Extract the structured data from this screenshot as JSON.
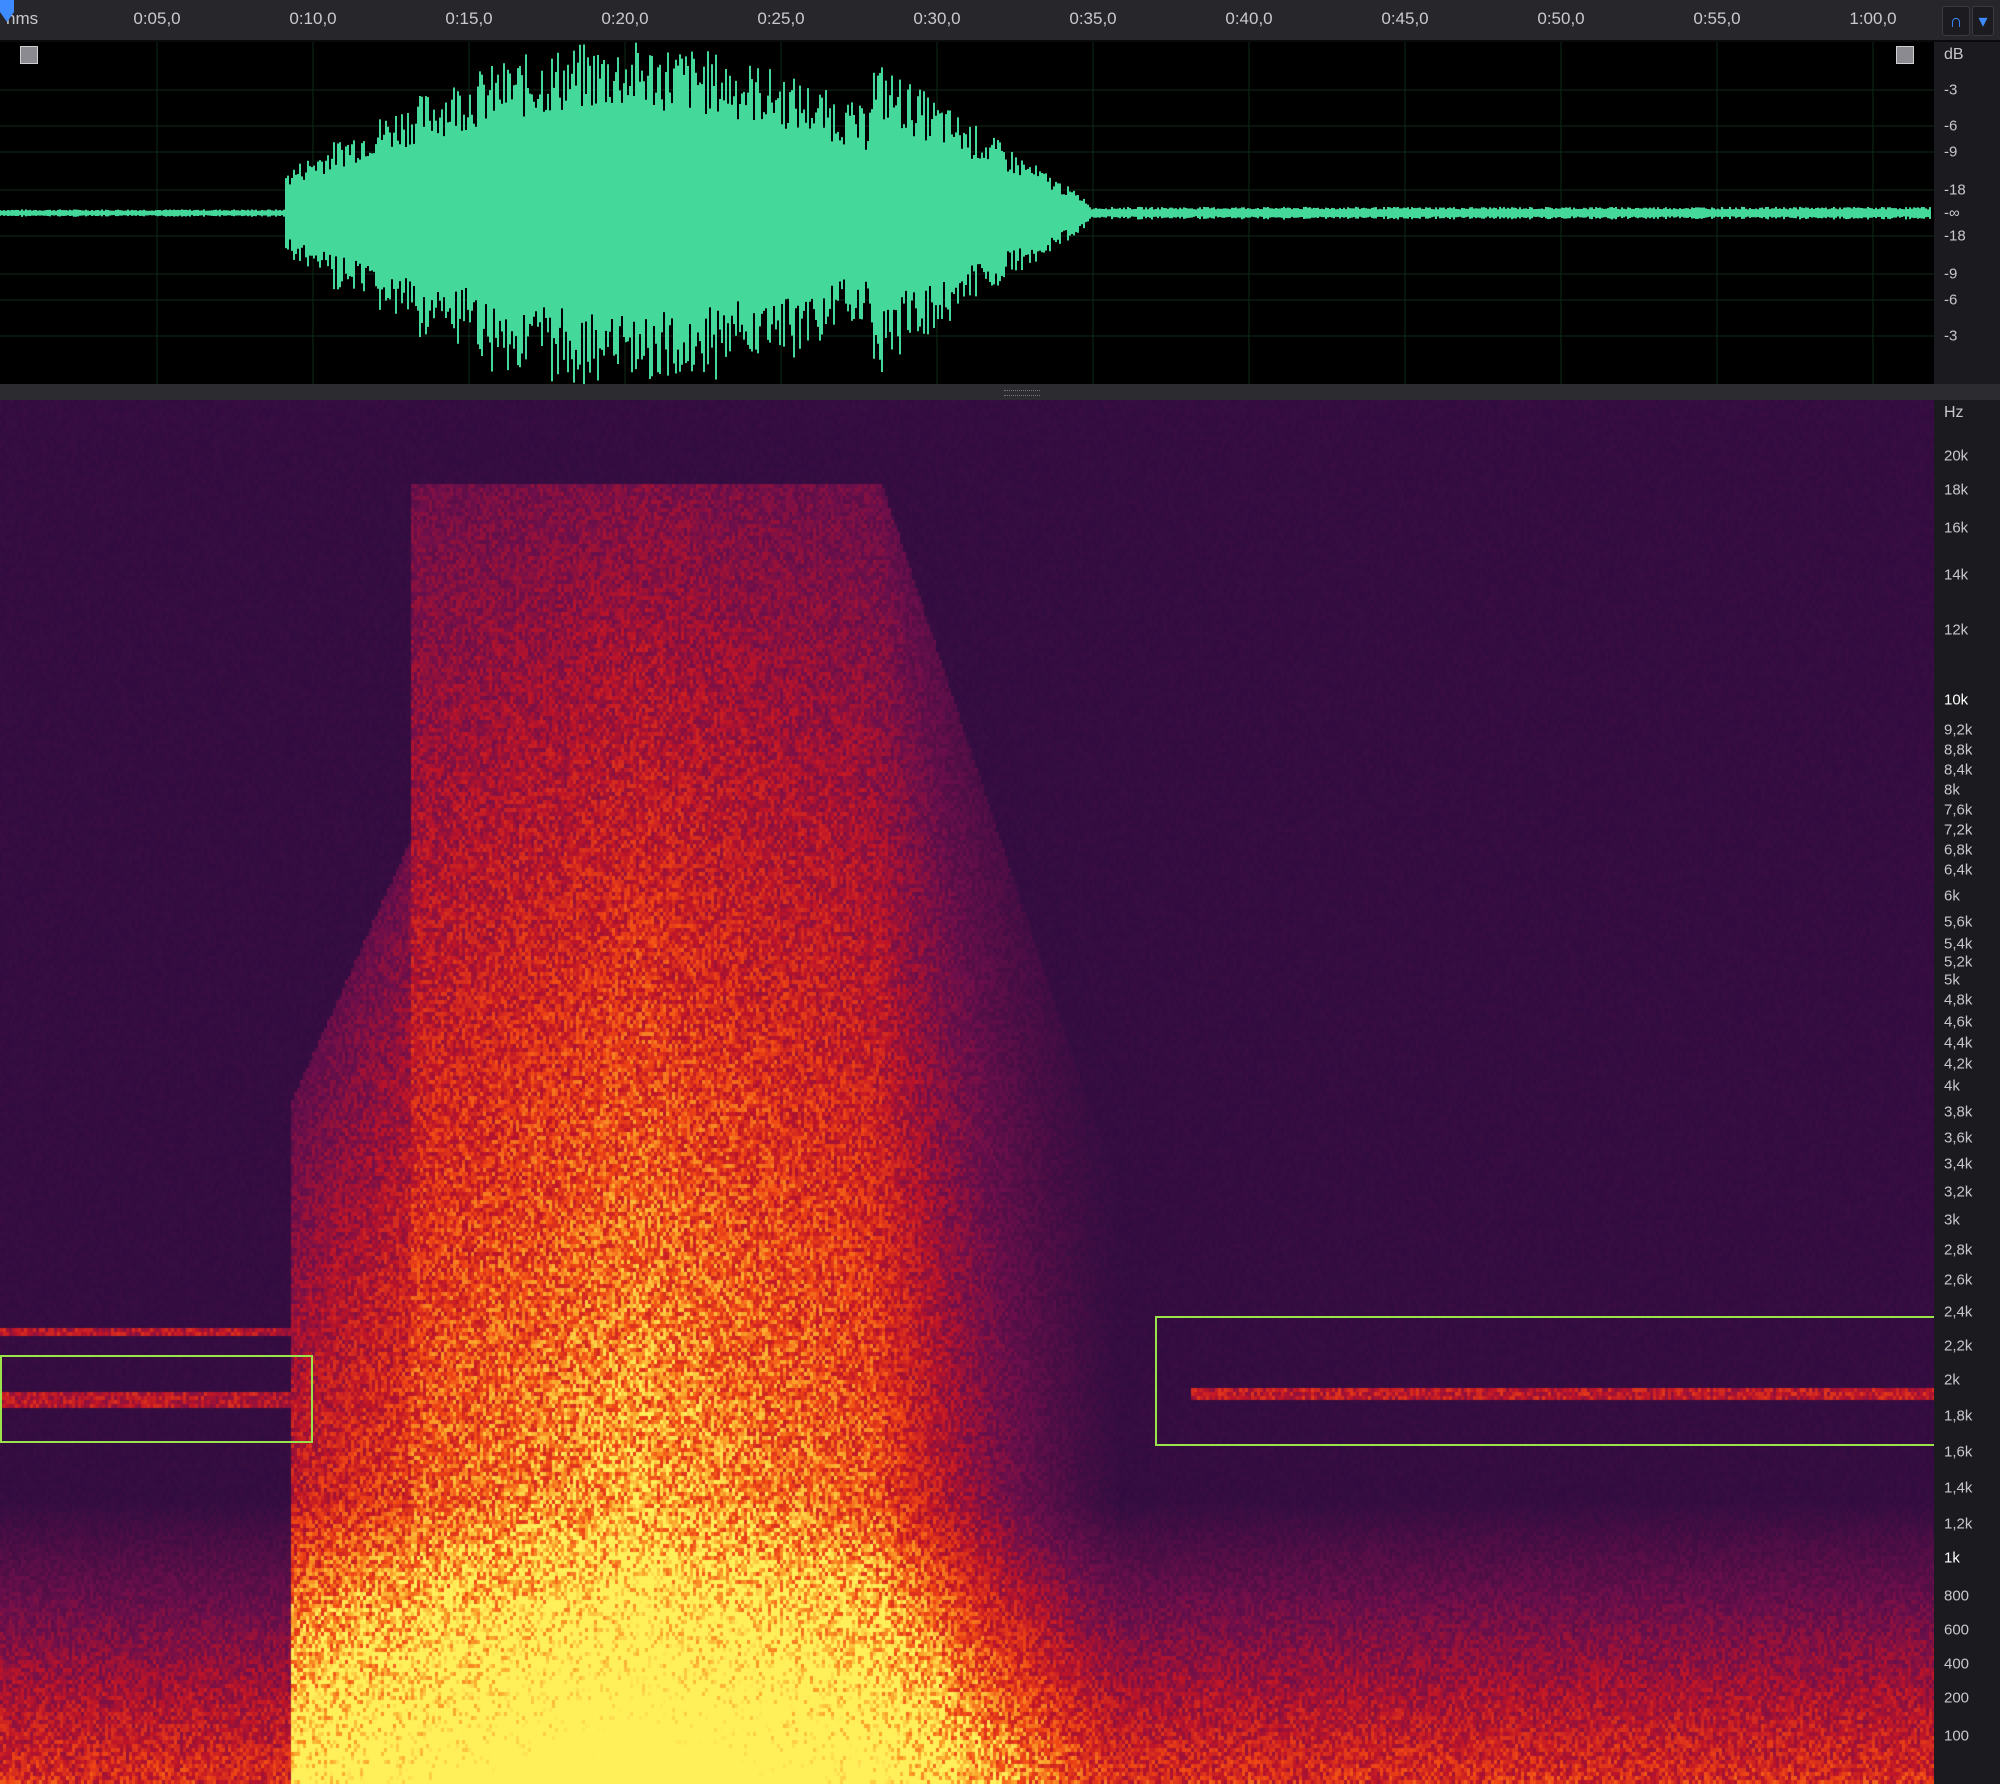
{
  "timeline": {
    "unit": "hms",
    "ticks": [
      "0:05,0",
      "0:10,0",
      "0:15,0",
      "0:20,0",
      "0:25,0",
      "0:30,0",
      "0:35,0",
      "0:40,0",
      "0:45,0",
      "0:50,0",
      "0:55,0",
      "1:00,0"
    ]
  },
  "toolbar": {
    "buttons": [
      {
        "icon": "headphones-icon",
        "glyph": "∩"
      },
      {
        "icon": "marker-icon",
        "glyph": "▾"
      }
    ]
  },
  "waveform": {
    "color": "#44d89a",
    "db_unit": "dB",
    "db_labels": [
      "-3",
      "-6",
      "-9",
      "-18",
      "-∞",
      "-18",
      "-9",
      "-6",
      "-3"
    ]
  },
  "spectrogram": {
    "hz_unit": "Hz",
    "hz_labels": [
      "20k",
      "18k",
      "16k",
      "14k",
      "12k",
      "10k",
      "9,2k",
      "8,8k",
      "8,4k",
      "8k",
      "7,6k",
      "7,2k",
      "6,8k",
      "6,4k",
      "6k",
      "5,6k",
      "5,4k",
      "5,2k",
      "5k",
      "4,8k",
      "4,6k",
      "4,4k",
      "4,2k",
      "4k",
      "3,8k",
      "3,6k",
      "3,4k",
      "3,2k",
      "3k",
      "2,8k",
      "2,6k",
      "2,4k",
      "2,2k",
      "2k",
      "1,8k",
      "1,6k",
      "1,4k",
      "1,2k",
      "1k",
      "800",
      "600",
      "400",
      "200",
      "100"
    ]
  },
  "colors": {
    "selection": "#9be34a",
    "background": "#2a0f45"
  }
}
